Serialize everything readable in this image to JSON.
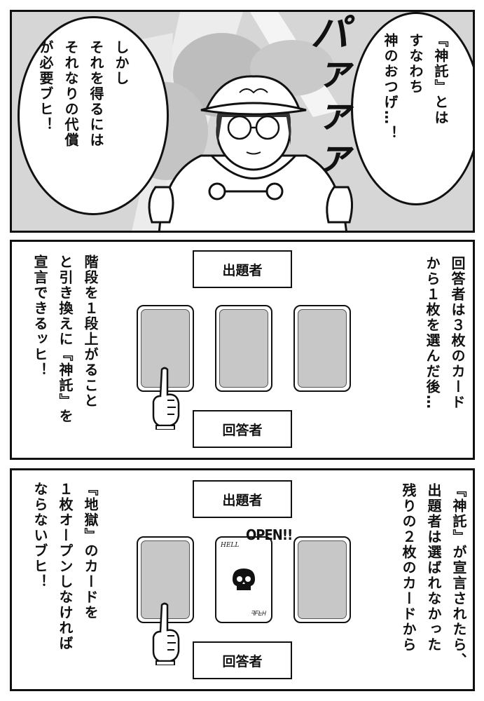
{
  "panel1": {
    "bubble_right": "『神託』とは\nすなわち\n神のおつげ…！",
    "bubble_left": "しかし\nそれを得るには\nそれなりの代償\nが必要ブヒ！",
    "sfx": "パァァァ"
  },
  "panel2": {
    "narration_right": "回答者は３枚のカード\nから１枚を選んだ後…",
    "narration_left": "階段を１段上がること\nと引き換えに『神託』を\n宣言できるッヒ！",
    "top_label": "出題者",
    "bottom_label": "回答者"
  },
  "panel3": {
    "narration_right": "『神託』が宣言されたら、\n出題者は選ばれなかった\n残りの２枚のカードから",
    "narration_left": "『地獄』のカードを\n１枚オープンしなければ\nならないブヒ！",
    "top_label": "出題者",
    "bottom_label": "回答者",
    "open_label": "OPEN!!",
    "card_top_text": "HELL",
    "card_bottom_text": "ᖷᖴᖶᕼ"
  }
}
